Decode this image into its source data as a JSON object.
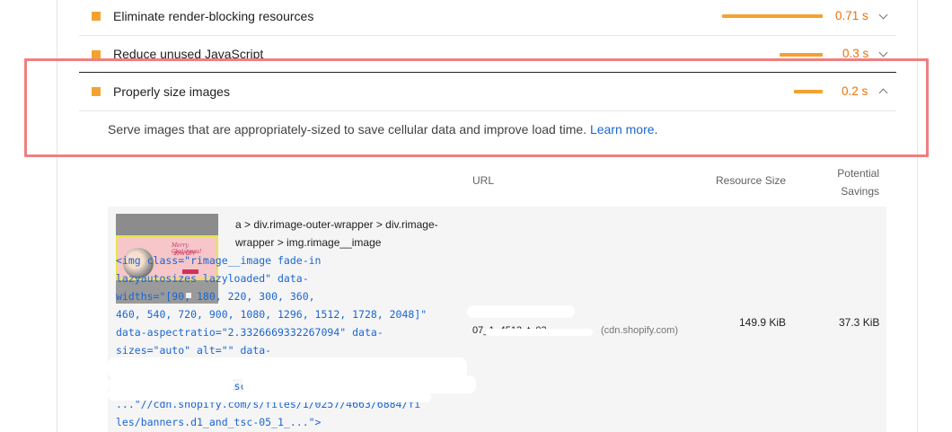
{
  "audits": [
    {
      "title": "Eliminate render-blocking resources",
      "savings": "0.71 s"
    },
    {
      "title": "Reduce unused JavaScript",
      "savings": "0.3 s"
    },
    {
      "title": "Properly size images",
      "savings": "0.2 s"
    }
  ],
  "details": {
    "description": "Serve images that are appropriately-sized to save cellular data and improve load time.",
    "learn_more": "Learn more",
    "period": "."
  },
  "table": {
    "headers": {
      "url": "URL",
      "resource_size": "Resource Size",
      "potential_savings_line1": "Potential",
      "potential_savings_line2": "Savings"
    },
    "rows": [
      {
        "selector": "a > div.rimage-outer-wrapper > div.rimage-wrapper > img.rimage__image",
        "snippet": "<img class=\"rimage__image fade-in\nlazyautosizes lazyloaded\" data-\nwidths=\"[90, 180, 220, 300, 360,\n460, 540, 720, 900, 1080, 1296, 1512, 1728, 2048]\"\ndata-aspectratio=\"2.3326669332267094\" data-\nsizes=\"auto\" alt=\"\" data-\nsrcset=\"//cdn.shopify.com/s/files/1/0257/4663/6884/fi\nles/banners...and_tsc-05_1_...\" srcset=\"1080w 1296w\n...\"//cdn.shopify.com/s/files/1/0257/4663/6884/fi\nles/banners.d1_and_tsc-05_1_...\">",
        "url": "07_1_4513_t_03...",
        "host": "(cdn.shopify.com)",
        "resource_size": "149.9 KiB",
        "potential_savings": "37.3 KiB"
      }
    ]
  },
  "colors": {
    "average": "#f4a22f",
    "average_text": "#e8710a",
    "link": "#1a66d2",
    "highlight": "#ef7f80"
  }
}
